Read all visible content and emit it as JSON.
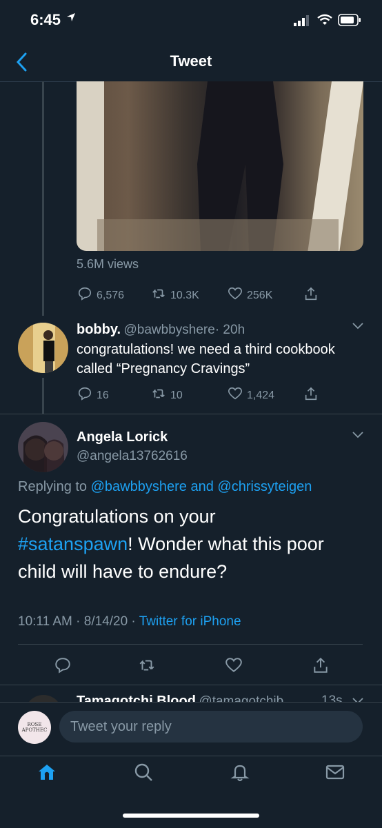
{
  "status": {
    "time": "6:45"
  },
  "nav": {
    "title": "Tweet"
  },
  "tweet": {
    "views": "5.6M views",
    "replies": "6,576",
    "retweets": "10.3K",
    "likes": "256K"
  },
  "reply1": {
    "name": "bobby.",
    "handle": "@bawbbyshere",
    "time": "· 20h",
    "text_line1": "congratulations! we need a third cookbook",
    "text_line2": "called “Pregnancy Cravings”",
    "replies": "16",
    "retweets": "10",
    "likes": "1,424"
  },
  "main": {
    "name": "Angela Lorick",
    "handle": "@angela13762616",
    "replying_prefix": "Replying to",
    "replying_user1": "@bawbbyshere",
    "replying_and": "and",
    "replying_user2": "@chrissyteigen",
    "text_line1": "Congratulations on your",
    "hashtag": "#satanspawn",
    "text_line2_rest": "! Wonder what this poor",
    "text_line3": "child will have to endure?",
    "timestamp": "10:11 AM · 8/14/20 ·",
    "source": "Twitter for iPhone"
  },
  "next_reply": {
    "name": "Tamagotchi Blood",
    "handle": "@tamagotchib...",
    "time": "13s"
  },
  "composer": {
    "placeholder": "Tweet your reply",
    "avatar_text": "ROSE APOTHEC"
  },
  "colors": {
    "background": "#15202b",
    "accent": "#1da1f2",
    "muted": "#8899a6",
    "divider": "#38444d"
  },
  "icons": {
    "back": "chevron-left-icon",
    "reply": "reply-icon",
    "retweet": "retweet-icon",
    "like": "heart-icon",
    "share": "share-icon",
    "home": "home-icon",
    "search": "search-icon",
    "notifications": "bell-icon",
    "messages": "mail-icon"
  }
}
